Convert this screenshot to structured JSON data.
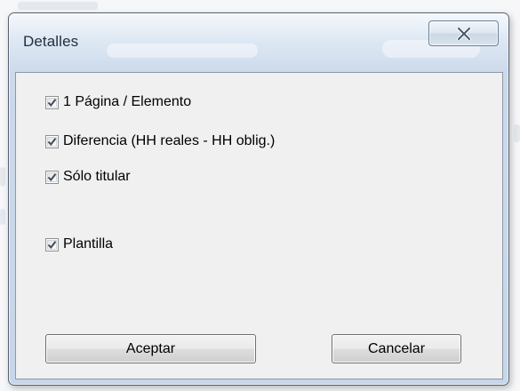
{
  "dialog": {
    "title": "Detalles",
    "close_icon": "close-icon",
    "options": [
      {
        "label": "1 Página / Elemento",
        "checked": true
      },
      {
        "label": "Diferencia (HH reales - HH oblig.)",
        "checked": true
      },
      {
        "label": "Sólo titular",
        "checked": true
      },
      {
        "label": "Plantilla",
        "checked": true
      }
    ],
    "buttons": {
      "accept_label": "Aceptar",
      "cancel_label": "Cancelar"
    }
  },
  "colors": {
    "frame": "#cbd9ea",
    "client": "#f0f0f0",
    "checkmark": "#404a57"
  }
}
